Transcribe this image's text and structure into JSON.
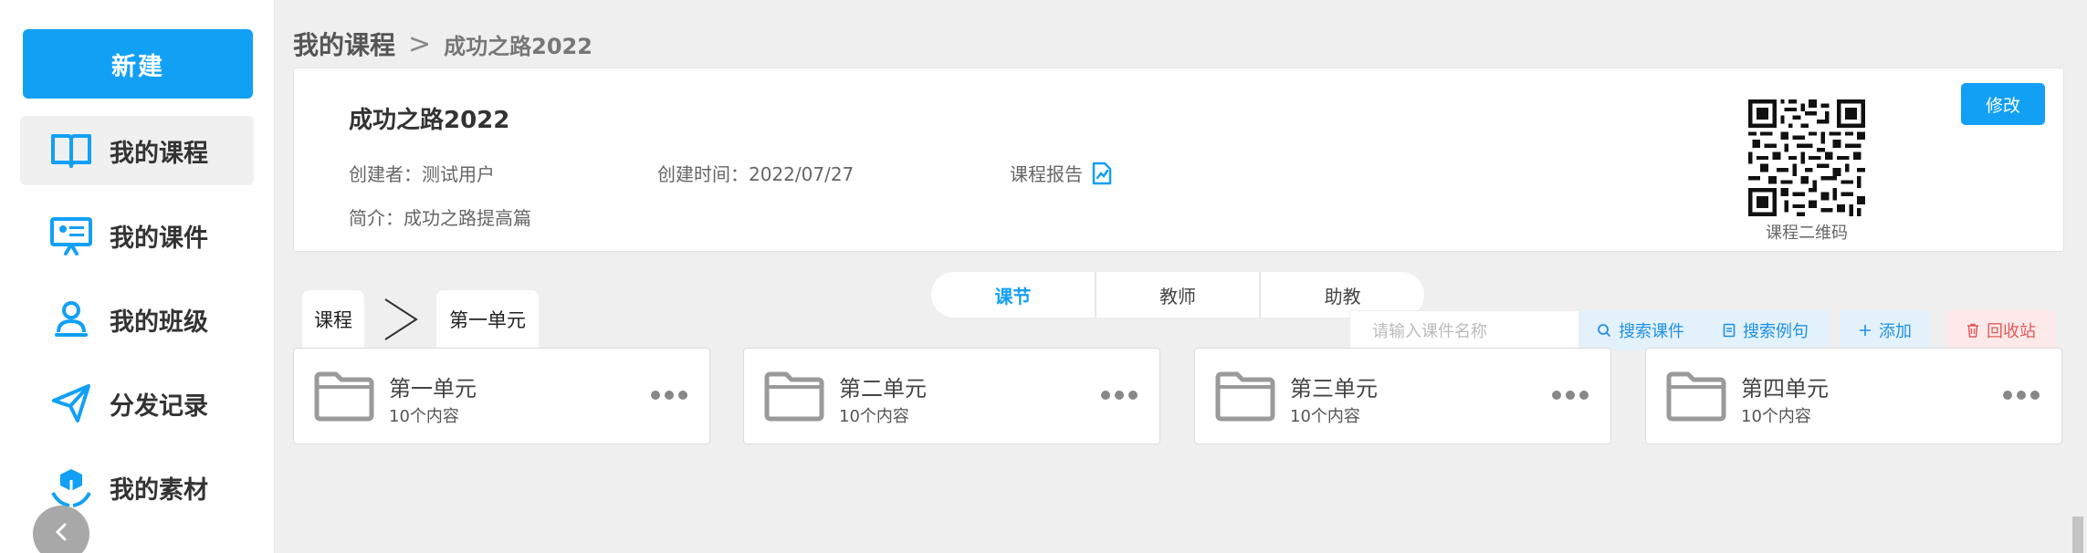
{
  "sidebar": {
    "new_label": "新建",
    "items": [
      {
        "label": "我的课程",
        "icon": "book-icon",
        "active": true
      },
      {
        "label": "我的课件",
        "icon": "presentation-icon",
        "active": false
      },
      {
        "label": "我的班级",
        "icon": "class-user-icon",
        "active": false
      },
      {
        "label": "分发记录",
        "icon": "send-icon",
        "active": false
      },
      {
        "label": "我的素材",
        "icon": "materials-icon",
        "active": false
      }
    ]
  },
  "breadcrumb": {
    "root": "我的课程",
    "separator": ">",
    "current": "成功之路2022"
  },
  "course": {
    "title": "成功之路2022",
    "creator": "创建者：测试用户",
    "created": "创建时间：2022/07/27",
    "report": "课程报告",
    "intro": "简介：成功之路提高篇",
    "qr_label": "课程二维码",
    "edit_label": "修改"
  },
  "tabs": [
    {
      "label": "课节",
      "active": true
    },
    {
      "label": "教师",
      "active": false
    },
    {
      "label": "助教",
      "active": false
    }
  ],
  "path": {
    "root": "课程",
    "current": "第一单元"
  },
  "toolbar": {
    "search_placeholder": "请输入课件名称",
    "search_courseware": "搜索课件",
    "search_cases": "搜索例句",
    "add": "添加",
    "recycle": "回收站"
  },
  "units": [
    {
      "name": "第一单元",
      "count": "10个内容"
    },
    {
      "name": "第二单元",
      "count": "10个内容"
    },
    {
      "name": "第三单元",
      "count": "10个内容"
    },
    {
      "name": "第四单元",
      "count": "10个内容"
    }
  ],
  "colors": {
    "accent": "#12a0f5",
    "danger": "#e05a5a",
    "background": "#efefef"
  }
}
